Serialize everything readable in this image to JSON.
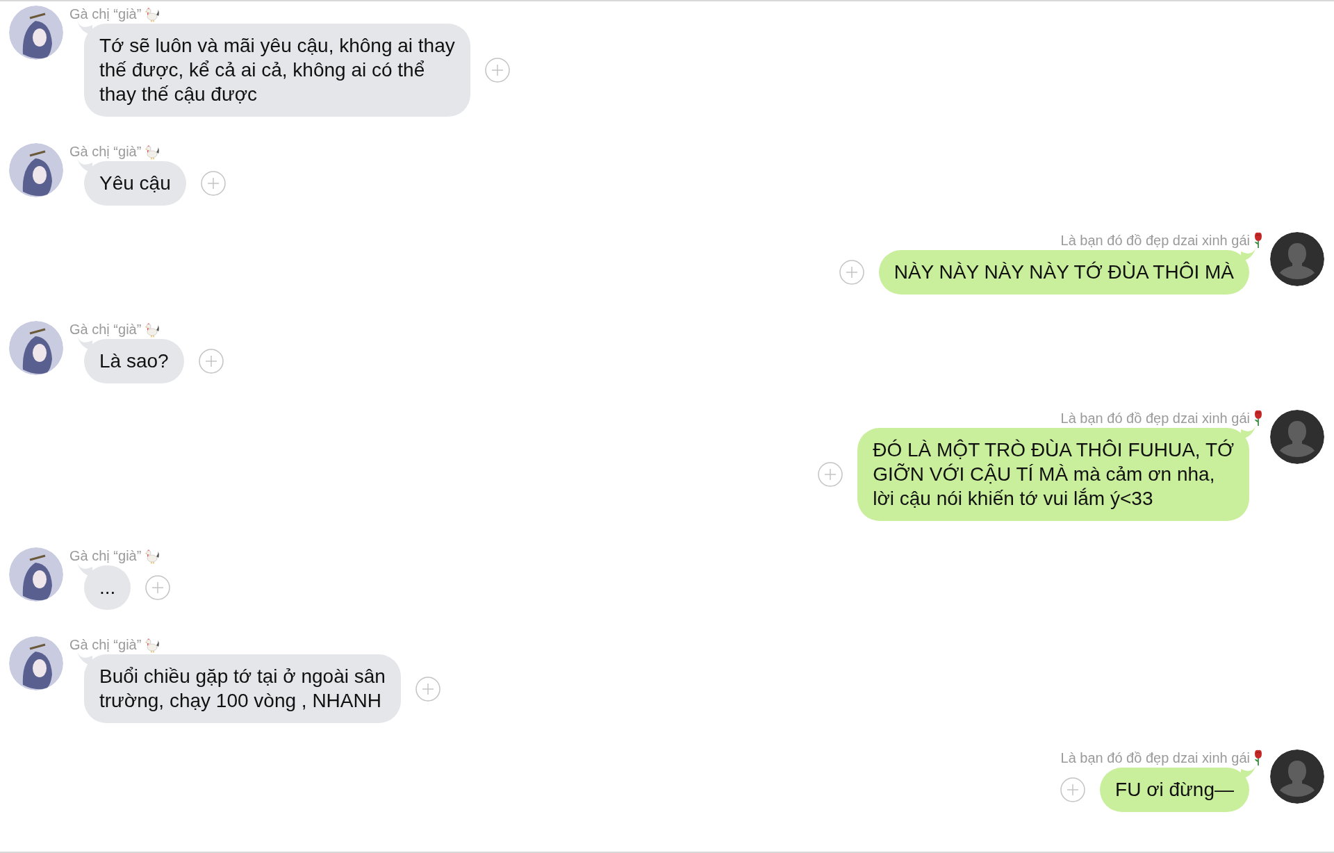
{
  "messages": [
    {
      "kind": "incoming",
      "sender": "Gà chị “già”",
      "text": "Tớ sẽ luôn và mãi yêu cậu, không ai thay\nthế được, kể cả ai cả, không ai có thể\nthay thế cậu được"
    },
    {
      "kind": "incoming",
      "sender": "Gà chị “già”",
      "text": "Yêu cậu"
    },
    {
      "kind": "outgoing",
      "sender": "Là bạn đó đồ đẹp dzai xinh gái",
      "text": "NÀY NÀY NÀY NÀY TỚ ĐÙA THÔI MÀ"
    },
    {
      "kind": "incoming",
      "sender": "Gà chị “già”",
      "text": "Là sao?"
    },
    {
      "kind": "outgoing",
      "sender": "Là bạn đó đồ đẹp dzai xinh gái",
      "text": "ĐÓ LÀ MỘT TRÒ ĐÙA THÔI FUHUA, TỚ\nGIỠN VỚI CẬU TÍ MÀ mà cảm ơn nha,\nlời cậu nói khiến tớ vui lắm ý<33"
    },
    {
      "kind": "incoming",
      "sender": "Gà chị “già”",
      "text": "..."
    },
    {
      "kind": "incoming",
      "sender": "Gà chị “già”",
      "text": "Buổi chiều gặp tớ tại ở ngoài sân\ntrường, chạy 100 vòng , NHANH"
    },
    {
      "kind": "outgoing",
      "sender": "Là bạn đó đồ đẹp dzai xinh gái",
      "text": "FU ơi đừng—"
    }
  ]
}
